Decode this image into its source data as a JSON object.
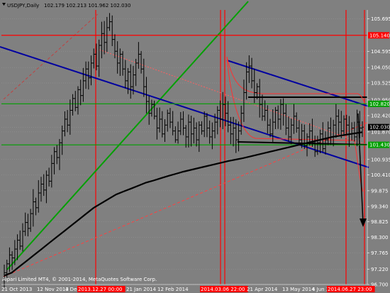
{
  "window": {
    "title": "USDJPY,Daily",
    "quote": "102.179 102.213 101.962 102.030"
  },
  "footer": {
    "credit": "Alpari Limited MT4, © 2001-2014, MetaQuotes Software Corp."
  },
  "colors": {
    "background": "#808080",
    "price_bar": "#000000",
    "grid": "#999999",
    "red_line": "#ff0000",
    "green_line": "#00a000",
    "blue_line": "#0000a0",
    "ma_line": "#000000"
  },
  "chart_data": {
    "type": "ohlc",
    "symbol": "USDJPY",
    "timeframe": "Daily",
    "ylim": [
      96.7,
      106.0
    ],
    "y_ticks": [
      105.695,
      105.14,
      104.595,
      104.05,
      103.525,
      102.95,
      102.42,
      102.03,
      101.87,
      101.43,
      100.935,
      100.41,
      99.875,
      99.34,
      98.825,
      98.3,
      97.765,
      97.22,
      96.7
    ],
    "x_labels": [
      "21 Oct 2013",
      "12 Nov 2013",
      "4 Dec 2013",
      "2013.12.27 00:00",
      "21 Jan 2014",
      "12 Feb 2014",
      "2014.03.06 22:00",
      "21 Apr 2014",
      "13 May 2014",
      "4 Jun 2014",
      "2014.06.27 23:00"
    ],
    "highlighted_x_labels": [
      "2013.12.27 00:00",
      "2014.03.06 22:00",
      "2014.06.27 23:00"
    ],
    "price_labels": [
      {
        "text": "105.140",
        "value": 105.14,
        "color": "#ff0000"
      },
      {
        "text": "102.820",
        "value": 102.82,
        "color": "#00a000"
      },
      {
        "text": "102.030",
        "value": 102.03,
        "color": "#000000"
      },
      {
        "text": "101.430",
        "value": 101.43,
        "color": "#00a000"
      }
    ],
    "horizontal_lines": [
      {
        "value": 105.14,
        "color": "#ff0000"
      },
      {
        "value": 102.82,
        "color": "#00a000"
      },
      {
        "value": 101.43,
        "color": "#00a000"
      }
    ],
    "series": [
      {
        "kind": "ohlc",
        "close": [
          97.1,
          97.4,
          97.7,
          97.6,
          97.9,
          98.2,
          98.0,
          98.5,
          98.8,
          98.6,
          99.1,
          99.5,
          99.3,
          99.8,
          100.1,
          99.9,
          100.4,
          100.2,
          100.8,
          101.2,
          101.0,
          101.5,
          101.9,
          102.3,
          102.1,
          102.6,
          103.0,
          102.7,
          103.3,
          103.1,
          103.6,
          104.0,
          103.7,
          104.2,
          104.5,
          104.1,
          104.8,
          105.2,
          104.9,
          105.4,
          105.6,
          105.0,
          104.6,
          104.2,
          104.5,
          104.0,
          103.6,
          103.9,
          103.4,
          103.8,
          104.2,
          104.5,
          104.0,
          103.4,
          102.9,
          102.5,
          102.8,
          102.4,
          102.0,
          102.3,
          101.8,
          102.1,
          102.5,
          102.2,
          101.9,
          101.6,
          101.9,
          102.3,
          102.0,
          101.7,
          102.2,
          101.8,
          102.0,
          101.6,
          102.1,
          101.9,
          102.4,
          102.0,
          101.7,
          101.9,
          102.2,
          102.6,
          102.3,
          102.8,
          102.5,
          102.1,
          101.8,
          102.0,
          101.6,
          101.9,
          102.5,
          103.2,
          103.9,
          104.1,
          103.6,
          103.2,
          103.4,
          102.8,
          102.4,
          102.6,
          102.1,
          101.8,
          102.2,
          102.6,
          102.3,
          102.8,
          102.5,
          102.0,
          101.7,
          102.1,
          102.4,
          102.0,
          101.6,
          101.9,
          101.4,
          101.7,
          101.9,
          101.5,
          101.2,
          101.5,
          101.8,
          101.3,
          101.6,
          102.0,
          101.7,
          102.1,
          102.4,
          102.2,
          101.9,
          102.3,
          102.1,
          101.8,
          102.0,
          101.7,
          102.2,
          102.0,
          102.03
        ]
      },
      {
        "kind": "moving_average",
        "values": [
          97.0,
          97.1,
          97.3,
          97.5,
          97.7,
          97.9,
          98.1,
          98.3,
          98.5,
          98.7,
          98.9,
          99.1,
          99.3,
          99.45,
          99.6,
          99.75,
          99.85,
          99.95,
          100.05,
          100.15,
          100.22,
          100.3,
          100.38,
          100.45,
          100.52,
          100.58,
          100.64,
          100.7,
          100.76,
          100.82,
          100.88,
          100.93,
          100.98,
          101.04,
          101.1,
          101.16,
          101.22,
          101.28,
          101.34,
          101.4,
          101.46,
          101.52,
          101.58,
          101.64,
          101.7,
          101.74,
          101.78,
          101.82,
          101.86
        ]
      }
    ]
  }
}
